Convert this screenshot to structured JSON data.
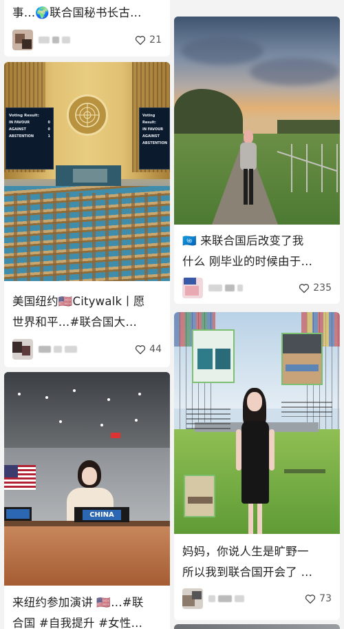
{
  "feed": {
    "cards": [
      {
        "title_lines": [
          "事…🌍联合国秘书长古…"
        ],
        "likes": "21"
      },
      {
        "title_lines": [
          "🇺🇳 来联合国后改变了我",
          "什么 刚毕业的时候由于…"
        ],
        "likes": "235"
      },
      {
        "image_panels": {
          "left": [
            "Voting Result:",
            "IN FAVOUR",
            "AGAINST",
            "ABSTENTION"
          ],
          "right": [
            "Voting Result:",
            "IN FAVOUR",
            "AGAINST",
            "ABSTENTION"
          ],
          "left_values": [
            "0",
            "0",
            "1"
          ]
        },
        "title_lines": [
          "美国纽约🇺🇸Citywalk丨愿",
          "世界和平…#联合国大…"
        ],
        "likes": "44"
      },
      {
        "title_lines": [
          "妈妈，你说人生是旷野一",
          "所以我到联合国开会了 …"
        ],
        "likes": "73"
      },
      {
        "image_text": "CHINA",
        "title_lines": [
          "来纽约参加演讲 🇺🇸…#联",
          "合国 #自我提升 #女性…"
        ]
      }
    ]
  }
}
